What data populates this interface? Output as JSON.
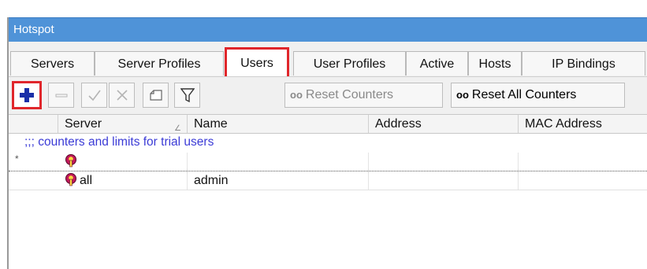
{
  "window": {
    "title": "Hotspot"
  },
  "tabs": [
    {
      "label": "Servers",
      "active": false
    },
    {
      "label": "Server Profiles",
      "active": false
    },
    {
      "label": "Users",
      "active": true
    },
    {
      "label": "User Profiles",
      "active": false
    },
    {
      "label": "Active",
      "active": false
    },
    {
      "label": "Hosts",
      "active": false
    },
    {
      "label": "IP Bindings",
      "active": false
    }
  ],
  "toolbar": {
    "buttons": [
      {
        "name": "add",
        "icon": "plus-icon",
        "highlighted": true
      },
      {
        "name": "remove",
        "icon": "minus-icon",
        "enabled": false
      },
      {
        "name": "enable",
        "icon": "check-icon",
        "enabled": false
      },
      {
        "name": "disable",
        "icon": "x-icon",
        "enabled": false
      },
      {
        "name": "comment",
        "icon": "note-icon",
        "enabled": true
      },
      {
        "name": "filter",
        "icon": "filter-icon",
        "enabled": true
      }
    ],
    "reset_counters": {
      "prefix": "oo",
      "label": "Reset Counters",
      "enabled": false
    },
    "reset_all_counters": {
      "prefix": "oo",
      "label": "Reset All Counters",
      "enabled": true
    }
  },
  "table": {
    "columns": [
      "Server",
      "Name",
      "Address",
      "MAC Address"
    ],
    "comment": ";;; counters and limits for trial users",
    "rows": [
      {
        "flag": "*",
        "server": "",
        "name": "",
        "address": "",
        "mac": ""
      },
      {
        "flag": "",
        "server": "all",
        "name": "admin",
        "address": "",
        "mac": ""
      }
    ]
  },
  "colors": {
    "titlebar": "#4f93d8",
    "highlight": "#e0262b",
    "comment_text": "#3b3bd6",
    "plus_icon": "#1a2fa8"
  }
}
